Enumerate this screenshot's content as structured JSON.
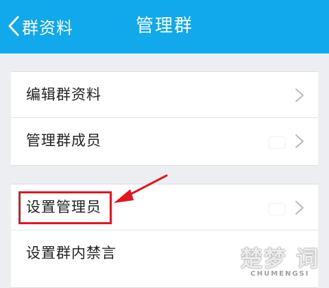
{
  "header": {
    "back_label": "群资料",
    "title": "管理群",
    "background": "#12a9ec"
  },
  "groups": [
    {
      "items": [
        {
          "label": "编辑群资料",
          "icon": "chevron-right-icon"
        },
        {
          "label": "管理群成员",
          "icon": "chevron-right-icon"
        }
      ]
    },
    {
      "items": [
        {
          "label": "设置管理员",
          "icon": "chevron-right-icon",
          "highlighted": true
        },
        {
          "label": "设置群内禁言",
          "icon": "chevron-right-icon"
        }
      ]
    }
  ],
  "annotation": {
    "color": "#e5161b",
    "target": "设置管理员"
  },
  "watermark": {
    "logo": "楚梦 词",
    "sub": "CHUMENGSI"
  }
}
